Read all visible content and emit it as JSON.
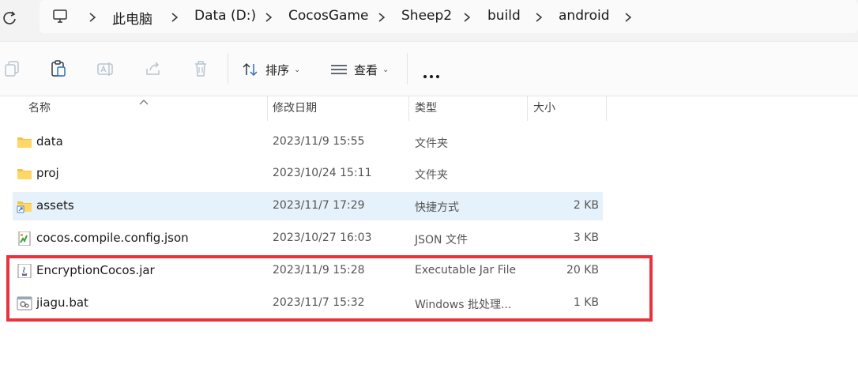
{
  "address_bar": {
    "crumbs": [
      "此电脑",
      "Data (D:)",
      "CocosGame",
      "Sheep2",
      "build",
      "android"
    ]
  },
  "toolbar": {
    "sort_label": "排序",
    "view_label": "查看"
  },
  "columns": {
    "name": "名称",
    "modified": "修改日期",
    "type": "类型",
    "size": "大小"
  },
  "files": [
    {
      "icon": "folder-icon",
      "name": "data",
      "modified": "2023/11/9 15:55",
      "type": "文件夹",
      "size": ""
    },
    {
      "icon": "folder-icon",
      "name": "proj",
      "modified": "2023/10/24 15:11",
      "type": "文件夹",
      "size": ""
    },
    {
      "icon": "shortcut-folder-icon",
      "name": "assets",
      "modified": "2023/11/7 17:29",
      "type": "快捷方式",
      "size": "2 KB"
    },
    {
      "icon": "json-file-icon",
      "name": "cocos.compile.config.json",
      "modified": "2023/10/27 16:03",
      "type": "JSON 文件",
      "size": "3 KB"
    },
    {
      "icon": "jar-file-icon",
      "name": "EncryptionCocos.jar",
      "modified": "2023/11/9 15:28",
      "type": "Executable Jar File",
      "size": "20 KB"
    },
    {
      "icon": "bat-file-icon",
      "name": "jiagu.bat",
      "modified": "2023/11/7 15:32",
      "type": "Windows 批处理...",
      "size": "1 KB"
    }
  ],
  "colors": {
    "selection": "#e5f1fb",
    "highlight_border": "#e8333d",
    "folder": "#f5c04a"
  }
}
